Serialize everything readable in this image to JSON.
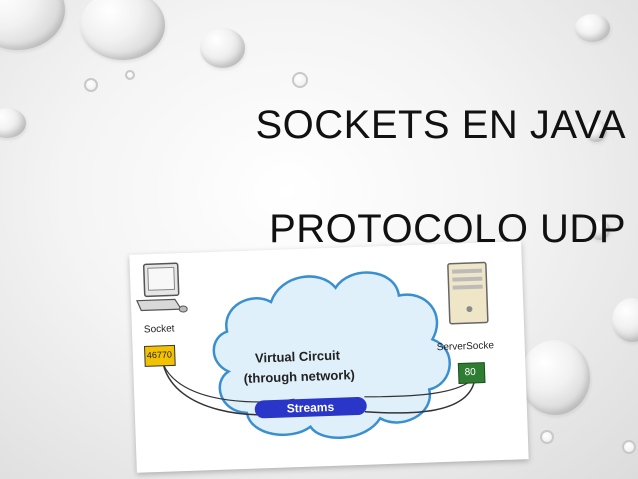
{
  "slide": {
    "title_line1": "SOCKETS EN JAVA",
    "title_line2": "PROTOCOLO UDP"
  },
  "diagram": {
    "client_label": "Socket",
    "client_port": "46770",
    "server_label": "ServerSocke",
    "server_port": "80",
    "cloud_line1": "Virtual Circuit",
    "cloud_line2": "(through network)",
    "streams_label": "Streams",
    "colors": {
      "port_box": "#f2c200",
      "server_port_box": "#2e7d32",
      "streams_pill": "#2a36c8",
      "cloud": "#dff0fb",
      "cloud_stroke": "#3a8fd0"
    },
    "icons": [
      "computer-icon",
      "server-icon",
      "cloud-icon"
    ]
  }
}
